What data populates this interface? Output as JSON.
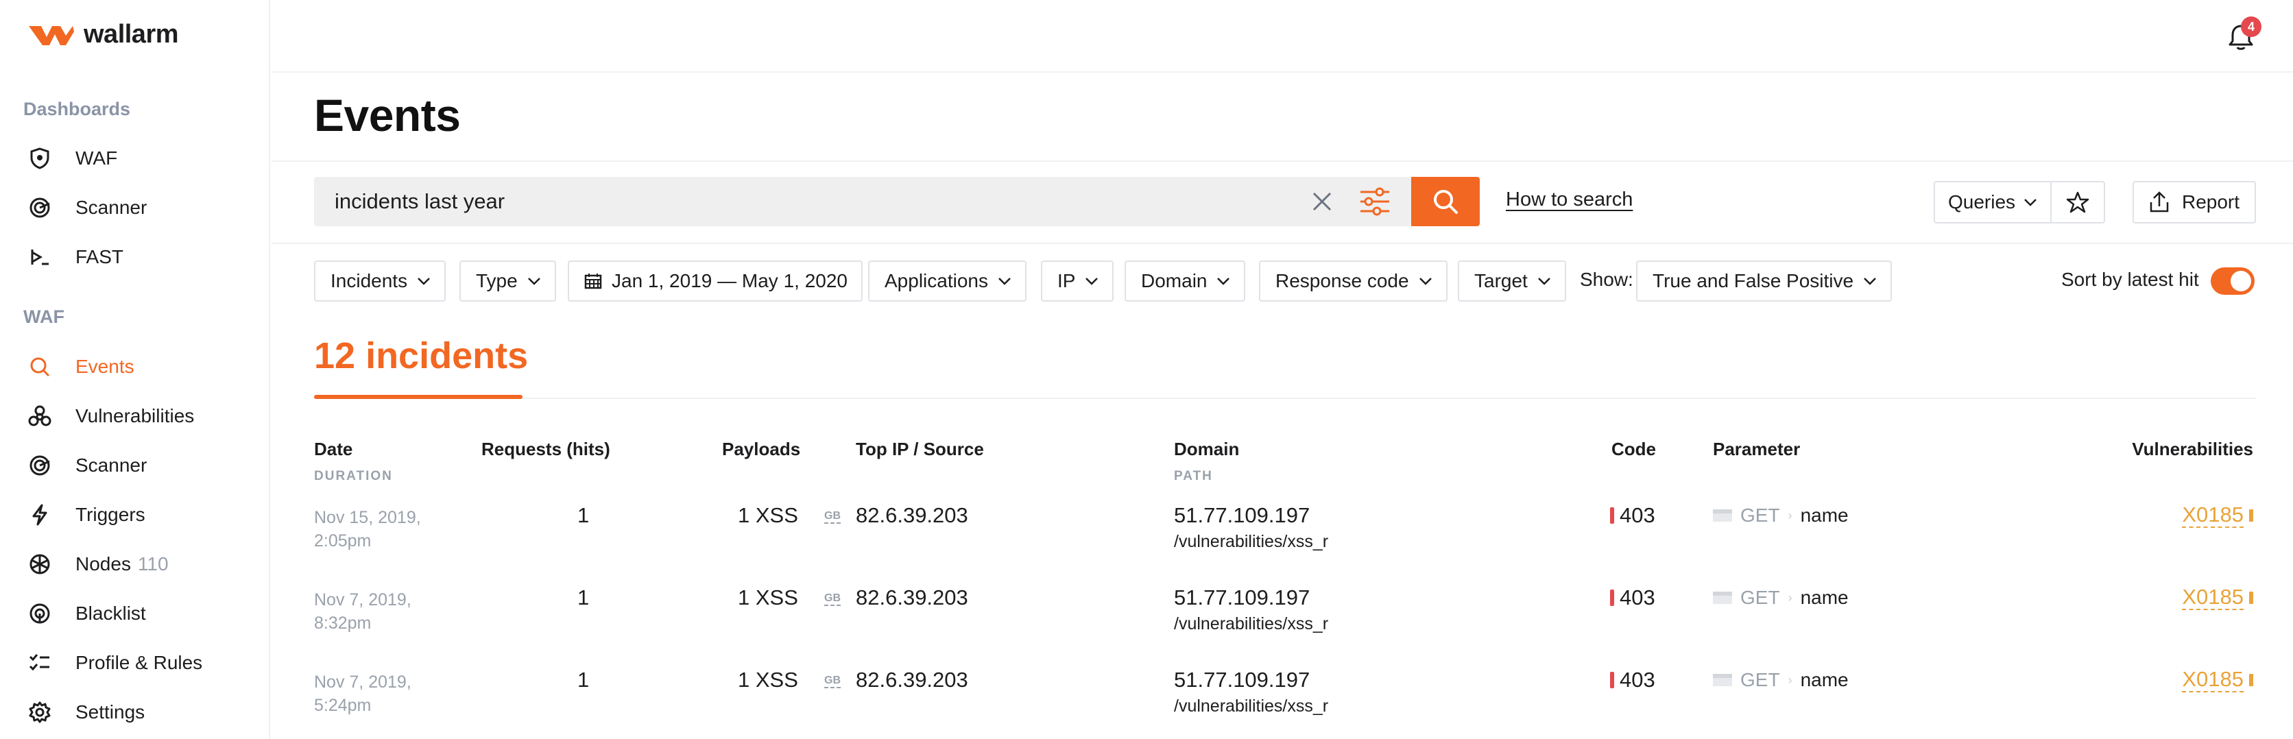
{
  "app": {
    "logo_text": "wallarm",
    "brand_color": "#f26722"
  },
  "notifications": {
    "count": "4"
  },
  "sidebar": {
    "sections": [
      {
        "label": "Dashboards"
      },
      {
        "label": "WAF"
      }
    ],
    "items": [
      {
        "label": "WAF",
        "icon": "shield-icon"
      },
      {
        "label": "Scanner",
        "icon": "scanner-icon"
      },
      {
        "label": "FAST",
        "icon": "terminal-icon"
      },
      {
        "label": "Events",
        "icon": "search-icon",
        "active": true
      },
      {
        "label": "Vulnerabilities",
        "icon": "biohazard-icon"
      },
      {
        "label": "Scanner",
        "icon": "scanner-icon"
      },
      {
        "label": "Triggers",
        "icon": "lightning-icon"
      },
      {
        "label": "Nodes",
        "count": "110",
        "icon": "nodes-icon"
      },
      {
        "label": "Blacklist",
        "icon": "blacklist-icon"
      },
      {
        "label": "Profile & Rules",
        "icon": "rules-icon"
      },
      {
        "label": "Settings",
        "icon": "gear-icon"
      }
    ]
  },
  "page": {
    "title": "Events"
  },
  "search": {
    "value": "incidents last year",
    "how_to_search": "How to search"
  },
  "toolbar": {
    "queries_label": "Queries",
    "report_label": "Report"
  },
  "filters": {
    "incidents": "Incidents",
    "type": "Type",
    "date_range": "Jan 1, 2019 — May 1, 2020",
    "applications": "Applications",
    "ip": "IP",
    "domain": "Domain",
    "response_code": "Response code",
    "target": "Target",
    "show_label": "Show:",
    "show_value": "True and False Positive",
    "sort_label": "Sort by latest hit",
    "sort_enabled": true
  },
  "incidents": {
    "title": "12 incidents"
  },
  "table": {
    "headers": {
      "date": "Date",
      "date_sub": "DURATION",
      "requests": "Requests (hits)",
      "payloads": "Payloads",
      "top_ip": "Top IP / Source",
      "domain": "Domain",
      "domain_sub": "PATH",
      "code": "Code",
      "parameter": "Parameter",
      "vulnerabilities": "Vulnerabilities"
    },
    "rows": [
      {
        "date1": "Nov 15, 2019,",
        "date2": "2:05pm",
        "hits": "1",
        "payloads": "1 XSS",
        "geo": "GB",
        "ip": "82.6.39.203",
        "domain": "51.77.109.197",
        "path": "/vulnerabilities/xss_r",
        "code": "403",
        "method": "GET",
        "param": "name",
        "vuln": "X0185"
      },
      {
        "date1": "Nov 7, 2019,",
        "date2": "8:32pm",
        "hits": "1",
        "payloads": "1 XSS",
        "geo": "GB",
        "ip": "82.6.39.203",
        "domain": "51.77.109.197",
        "path": "/vulnerabilities/xss_r",
        "code": "403",
        "method": "GET",
        "param": "name",
        "vuln": "X0185"
      },
      {
        "date1": "Nov 7, 2019,",
        "date2": "5:24pm",
        "hits": "1",
        "payloads": "1 XSS",
        "geo": "GB",
        "ip": "82.6.39.203",
        "domain": "51.77.109.197",
        "path": "/vulnerabilities/xss_r",
        "code": "403",
        "method": "GET",
        "param": "name",
        "vuln": "X0185"
      }
    ]
  }
}
